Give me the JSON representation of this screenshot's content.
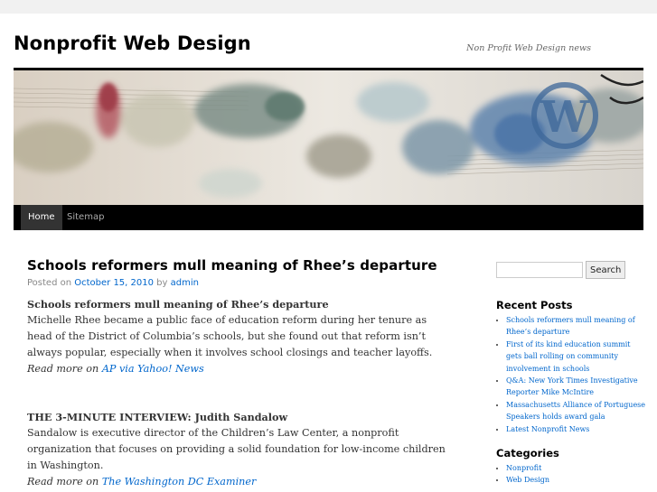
{
  "site": {
    "title": "Nonprofit Web Design",
    "description": "Non Profit Web Design news"
  },
  "nav": {
    "items": [
      {
        "label": "Home"
      },
      {
        "label": "Sitemap"
      }
    ]
  },
  "post": {
    "title": "Schools reformers mull meaning of Rhee’s departure",
    "meta_prefix": "Posted on",
    "date": "October 15, 2010",
    "by": "by",
    "author": "admin",
    "blocks": [
      {
        "heading": "Schools reformers mull meaning of Rhee’s departure",
        "body": "Michelle Rhee became a public face of education reform during her tenure as head of the District of Columbia’s schools, but she found out that reform isn’t always popular, especially when it involves school closings and teacher layoffs.",
        "read_more_prefix": "Read more on",
        "source": "AP via Yahoo! News"
      },
      {
        "heading": "THE 3-MINUTE INTERVIEW: Judith Sandalow",
        "body": "Sandalow is executive director of the Children’s Law Center, a nonprofit organization that focuses on providing a solid foundation for low-income children in Washington.",
        "read_more_prefix": "Read more on",
        "source": "The Washington DC Examiner"
      }
    ]
  },
  "sidebar": {
    "search": {
      "button": "Search",
      "value": ""
    },
    "recent_posts": {
      "title": "Recent Posts",
      "items": [
        "Schools reformers mull meaning of Rhee’s departure",
        "First of its kind education summit gets ball rolling on community involvement in schools",
        "Q&A: New York Times Investigative Reporter Mike McIntire",
        "Massachusetts Alliance of Portuguese Speakers holds award gala",
        "Latest Nonprofit News"
      ]
    },
    "categories": {
      "title": "Categories",
      "items": [
        "Nonprofit",
        "Web Design"
      ]
    }
  }
}
